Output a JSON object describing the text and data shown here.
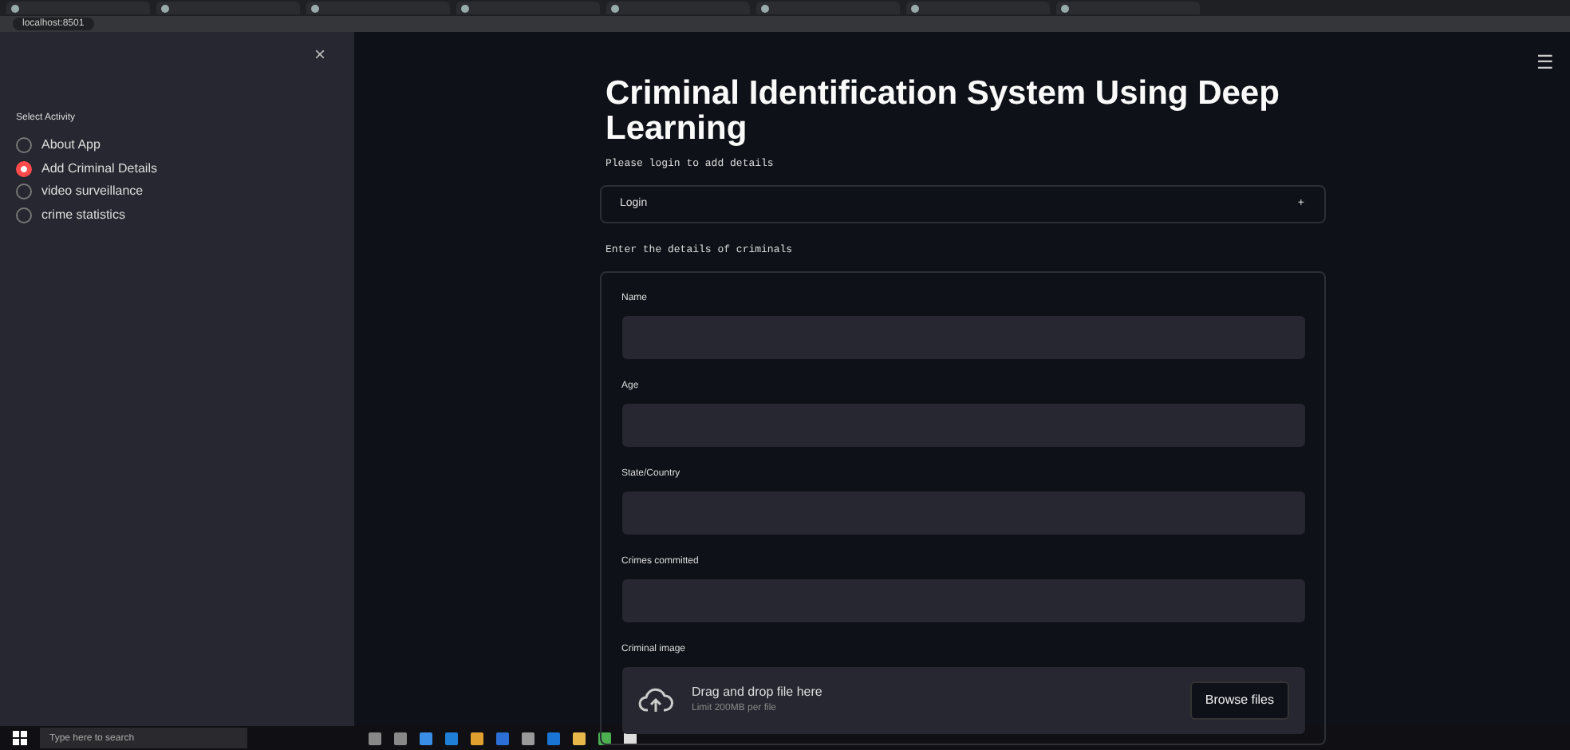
{
  "browser": {
    "address": "localhost:8501"
  },
  "sidebar": {
    "close": "×",
    "heading": "Select Activity",
    "options": [
      {
        "label": "About App",
        "selected": false
      },
      {
        "label": "Add Criminal Details",
        "selected": true
      },
      {
        "label": "video surveillance",
        "selected": false
      },
      {
        "label": "crime statistics",
        "selected": false
      }
    ]
  },
  "main": {
    "menu": "☰",
    "title": "Criminal Identification System Using Deep Learning",
    "login_note": "Please login to add details",
    "expander": {
      "label": "Login",
      "toggle": "+"
    },
    "form_note": "Enter the details of criminals",
    "fields": [
      {
        "label": "Name"
      },
      {
        "label": "Age"
      },
      {
        "label": "State/Country"
      },
      {
        "label": "Crimes committed"
      }
    ],
    "upload": {
      "label": "Criminal image",
      "prompt": "Drag and drop file here",
      "limit": "Limit 200MB per file",
      "button": "Browse files"
    }
  },
  "taskbar": {
    "search_placeholder": "Type here to search"
  }
}
